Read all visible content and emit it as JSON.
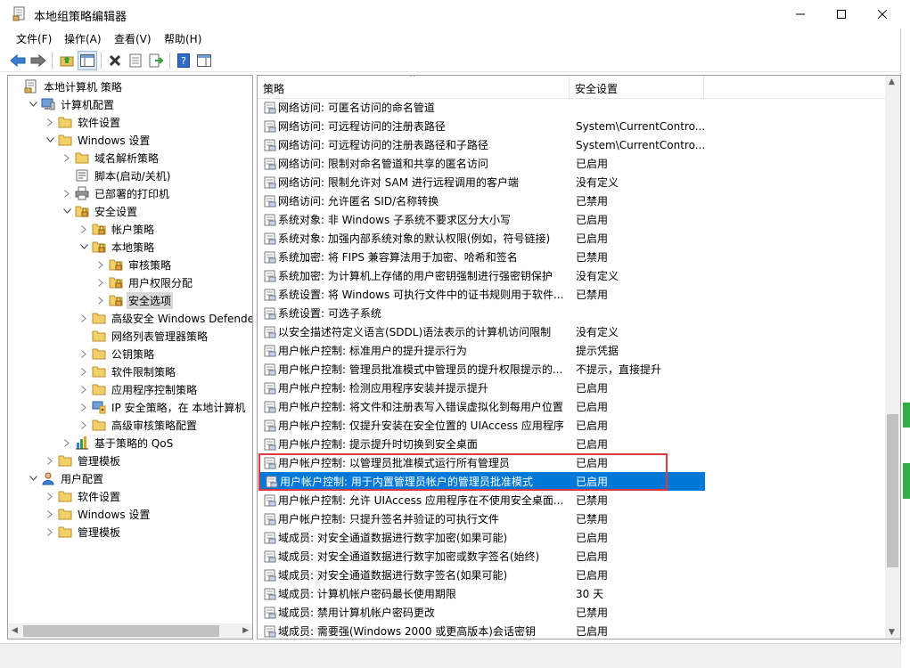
{
  "window": {
    "title": "本地组策略编辑器"
  },
  "menu": [
    "文件(F)",
    "操作(A)",
    "查看(V)",
    "帮助(H)"
  ],
  "tree": [
    {
      "label": "本地计算机 策略",
      "level": 0,
      "twisty": "",
      "icon": "computer-policy"
    },
    {
      "label": "计算机配置",
      "level": 1,
      "twisty": "open",
      "icon": "computer"
    },
    {
      "label": "软件设置",
      "level": 2,
      "twisty": "closed",
      "icon": "folder"
    },
    {
      "label": "Windows 设置",
      "level": 2,
      "twisty": "open",
      "icon": "folder"
    },
    {
      "label": "域名解析策略",
      "level": 3,
      "twisty": "closed",
      "icon": "folder"
    },
    {
      "label": "脚本(启动/关机)",
      "level": 3,
      "twisty": "",
      "icon": "script"
    },
    {
      "label": "已部署的打印机",
      "level": 3,
      "twisty": "closed",
      "icon": "printer"
    },
    {
      "label": "安全设置",
      "level": 3,
      "twisty": "open",
      "icon": "folder-lock"
    },
    {
      "label": "帐户策略",
      "level": 4,
      "twisty": "closed",
      "icon": "folder-lock"
    },
    {
      "label": "本地策略",
      "level": 4,
      "twisty": "open",
      "icon": "folder-lock"
    },
    {
      "label": "审核策略",
      "level": 5,
      "twisty": "closed",
      "icon": "folder-lock"
    },
    {
      "label": "用户权限分配",
      "level": 5,
      "twisty": "closed",
      "icon": "folder-lock"
    },
    {
      "label": "安全选项",
      "level": 5,
      "twisty": "closed",
      "icon": "folder-lock",
      "selected": true
    },
    {
      "label": "高级安全 Windows Defender 防",
      "level": 4,
      "twisty": "closed",
      "icon": "folder"
    },
    {
      "label": "网络列表管理器策略",
      "level": 4,
      "twisty": "",
      "icon": "folder"
    },
    {
      "label": "公钥策略",
      "level": 4,
      "twisty": "closed",
      "icon": "folder"
    },
    {
      "label": "软件限制策略",
      "level": 4,
      "twisty": "closed",
      "icon": "folder"
    },
    {
      "label": "应用程序控制策略",
      "level": 4,
      "twisty": "closed",
      "icon": "folder"
    },
    {
      "label": "IP 安全策略，在 本地计算机",
      "level": 4,
      "twisty": "closed",
      "icon": "ip-security"
    },
    {
      "label": "高级审核策略配置",
      "level": 4,
      "twisty": "closed",
      "icon": "folder"
    },
    {
      "label": "基于策略的 QoS",
      "level": 3,
      "twisty": "closed",
      "icon": "chart"
    },
    {
      "label": "管理模板",
      "level": 2,
      "twisty": "closed",
      "icon": "folder"
    },
    {
      "label": "用户配置",
      "level": 1,
      "twisty": "open",
      "icon": "user"
    },
    {
      "label": "软件设置",
      "level": 2,
      "twisty": "closed",
      "icon": "folder"
    },
    {
      "label": "Windows 设置",
      "level": 2,
      "twisty": "closed",
      "icon": "folder"
    },
    {
      "label": "管理模板",
      "level": 2,
      "twisty": "closed",
      "icon": "folder"
    }
  ],
  "list": {
    "columns": [
      "策略",
      "安全设置"
    ],
    "rows": [
      {
        "name": "网络访问: 可匿名访问的命名管道",
        "value": ""
      },
      {
        "name": "网络访问: 可远程访问的注册表路径",
        "value": "System\\CurrentContro..."
      },
      {
        "name": "网络访问: 可远程访问的注册表路径和子路径",
        "value": "System\\CurrentContro..."
      },
      {
        "name": "网络访问: 限制对命名管道和共享的匿名访问",
        "value": "已启用"
      },
      {
        "name": "网络访问: 限制允许对 SAM 进行远程调用的客户端",
        "value": "没有定义"
      },
      {
        "name": "网络访问: 允许匿名 SID/名称转换",
        "value": "已禁用"
      },
      {
        "name": "系统对象: 非 Windows 子系统不要求区分大小写",
        "value": "已启用"
      },
      {
        "name": "系统对象: 加强内部系统对象的默认权限(例如，符号链接)",
        "value": "已启用"
      },
      {
        "name": "系统加密: 将 FIPS 兼容算法用于加密、哈希和签名",
        "value": "已禁用"
      },
      {
        "name": "系统加密: 为计算机上存储的用户密钥强制进行强密钥保护",
        "value": "没有定义"
      },
      {
        "name": "系统设置: 将 Windows 可执行文件中的证书规则用于软件...",
        "value": "已禁用"
      },
      {
        "name": "系统设置: 可选子系统",
        "value": ""
      },
      {
        "name": "以安全描述符定义语言(SDDL)语法表示的计算机访问限制",
        "value": "没有定义"
      },
      {
        "name": "用户帐户控制: 标准用户的提升提示行为",
        "value": "提示凭据"
      },
      {
        "name": "用户帐户控制: 管理员批准模式中管理员的提升权限提示的...",
        "value": "不提示，直接提升"
      },
      {
        "name": "用户帐户控制: 检测应用程序安装并提示提升",
        "value": "已启用"
      },
      {
        "name": "用户帐户控制: 将文件和注册表写入错误虚拟化到每用户位置",
        "value": "已启用"
      },
      {
        "name": "用户帐户控制: 仅提升安装在安全位置的 UIAccess 应用程序",
        "value": "已启用"
      },
      {
        "name": "用户帐户控制: 提示提升时切换到安全桌面",
        "value": "已启用"
      },
      {
        "name": "用户帐户控制: 以管理员批准模式运行所有管理员",
        "value": "已启用"
      },
      {
        "name": "用户帐户控制: 用于内置管理员帐户的管理员批准模式",
        "value": "已启用",
        "selected": true
      },
      {
        "name": "用户帐户控制: 允许 UIAccess 应用程序在不使用安全桌面...",
        "value": "已禁用"
      },
      {
        "name": "用户帐户控制: 只提升签名并验证的可执行文件",
        "value": "已禁用"
      },
      {
        "name": "域成员: 对安全通道数据进行数字加密(如果可能)",
        "value": "已启用"
      },
      {
        "name": "域成员: 对安全通道数据进行数字加密或数字签名(始终)",
        "value": "已启用"
      },
      {
        "name": "域成员: 对安全通道数据进行数字签名(如果可能)",
        "value": "已启用"
      },
      {
        "name": "域成员: 计算机帐户密码最长使用期限",
        "value": "30 天"
      },
      {
        "name": "域成员: 禁用计算机帐户密码更改",
        "value": "已禁用"
      },
      {
        "name": "域成员: 需要强(Windows 2000 或更高版本)会话密钥",
        "value": "已启用"
      }
    ]
  },
  "colors": {
    "selection": "#0078d7",
    "highlight_box": "#e0383e"
  }
}
